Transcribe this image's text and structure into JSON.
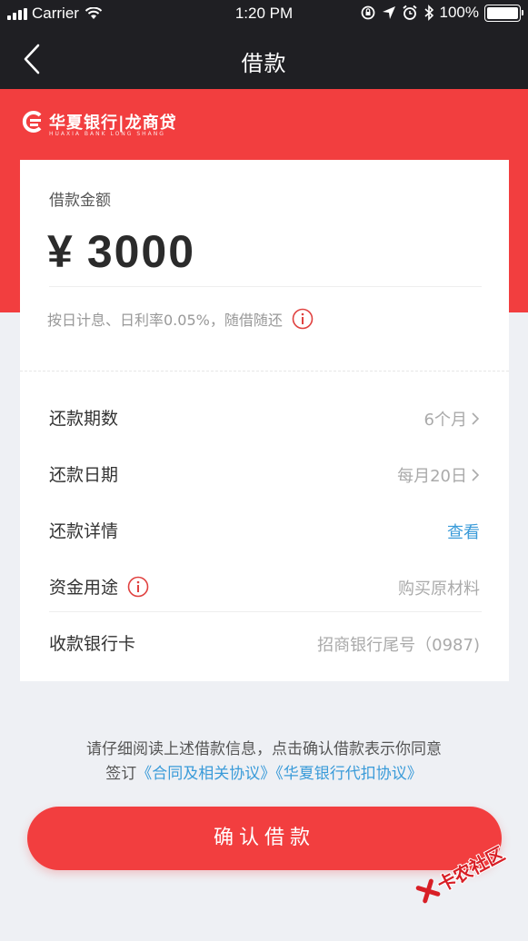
{
  "status_bar": {
    "carrier": "Carrier",
    "time": "1:20 PM",
    "battery": "100%"
  },
  "nav": {
    "title": "借款"
  },
  "brand": {
    "name": "华夏银行|龙商贷",
    "sub": "HUAXIA BANK  LONG SHANG"
  },
  "loan": {
    "amount_label": "借款金额",
    "currency": "¥",
    "amount": "3000",
    "interest_note": "按日计息、日利率0.05%，随借随还"
  },
  "rows": [
    {
      "label": "还款期数",
      "value": "6个月"
    },
    {
      "label": "还款日期",
      "value": "每月20日"
    },
    {
      "label": "还款详情",
      "value": "查看"
    },
    {
      "label": "资金用途",
      "value": "购买原材料"
    },
    {
      "label": "收款银行卡",
      "value": "招商银行尾号（0987)"
    }
  ],
  "notice": {
    "line1": "请仔细阅读上述借款信息，点击确认借款表示你同意",
    "prefix": "签订",
    "contract_link": "《合同及相关协议》",
    "deduct_link": "《华夏银行代扣协议》"
  },
  "confirm_button": "确认借款",
  "watermark": "卡农社区",
  "colors": {
    "brand_red": "#f23e3f",
    "dark_bar": "#1f1f23",
    "link_blue": "#3a9bd9"
  }
}
